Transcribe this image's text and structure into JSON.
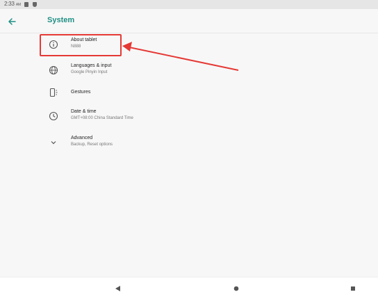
{
  "status_bar": {
    "time": "2:33",
    "time_suffix": "AM"
  },
  "app_bar": {
    "title": "System"
  },
  "settings": [
    {
      "title": "About tablet",
      "summary": "N888",
      "icon": "info-icon"
    },
    {
      "title": "Languages & input",
      "summary": "Google Pinyin Input",
      "icon": "globe-icon"
    },
    {
      "title": "Gestures",
      "summary": "",
      "icon": "gestures-icon"
    },
    {
      "title": "Date & time",
      "summary": "GMT+08:00 China Standard Time",
      "icon": "clock-icon"
    },
    {
      "title": "Advanced",
      "summary": "Backup, Reset options",
      "icon": "chevron-down-icon"
    }
  ],
  "colors": {
    "accent": "#1f8f84",
    "highlight": "#e53935"
  }
}
